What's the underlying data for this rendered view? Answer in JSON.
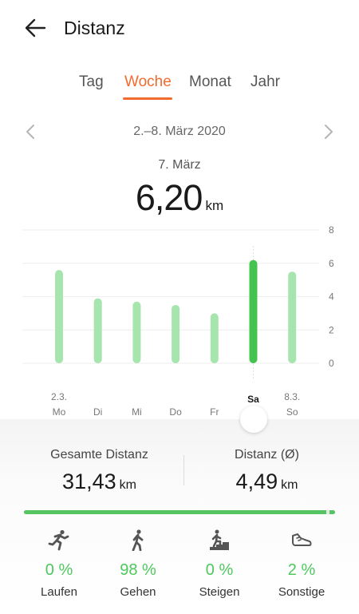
{
  "header": {
    "title": "Distanz"
  },
  "tabs": [
    {
      "label": "Tag"
    },
    {
      "label": "Woche",
      "active": true
    },
    {
      "label": "Monat"
    },
    {
      "label": "Jahr"
    }
  ],
  "range": {
    "label": "2.–8. März 2020"
  },
  "selected": {
    "date": "7. März",
    "value": "6,20",
    "unit": "km"
  },
  "chart_data": {
    "type": "bar",
    "categories": [
      "Mo",
      "Di",
      "Mi",
      "Do",
      "Fr",
      "Sa",
      "So"
    ],
    "dates": [
      "2.3.",
      "",
      "",
      "",
      "",
      "",
      "8.3."
    ],
    "values": [
      5.6,
      3.9,
      3.7,
      3.5,
      3.0,
      6.2,
      5.5
    ],
    "selected_index": 5,
    "y_ticks": [
      "8",
      "6",
      "4",
      "2",
      "0"
    ],
    "ylim": [
      0,
      8
    ],
    "colors": {
      "bar": "#a6e5ad",
      "selected": "#45c34f"
    }
  },
  "stats": {
    "total_label": "Gesamte Distanz",
    "total_value": "31,43",
    "total_unit": "km",
    "avg_label": "Distanz (Ø)",
    "avg_value": "4,49",
    "avg_unit": "km"
  },
  "progress": {
    "fraction": 0.98,
    "color": "#55c463"
  },
  "activities": [
    {
      "icon": "running-icon",
      "pct": "0 %",
      "label": "Laufen"
    },
    {
      "icon": "walking-icon",
      "pct": "98 %",
      "label": "Gehen"
    },
    {
      "icon": "stairs-climbing-icon",
      "pct": "0 %",
      "label": "Steigen"
    },
    {
      "icon": "shoe-icon",
      "pct": "2 %",
      "label": "Sonstige"
    }
  ],
  "colors": {
    "accent": "#f26a2e",
    "green": "#4cc85c"
  }
}
